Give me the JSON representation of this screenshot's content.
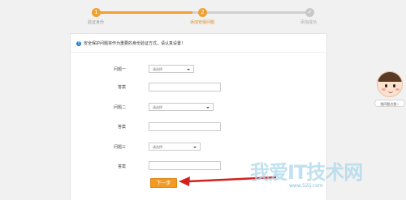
{
  "progress": {
    "steps": [
      {
        "number": "1",
        "label": "验证身份",
        "status": "done"
      },
      {
        "number": "2",
        "label": "添加安保问题",
        "status": "current"
      },
      {
        "number": "",
        "label": "添加成功",
        "status": "pending"
      }
    ],
    "colors": {
      "done": "#f0a02f",
      "current": "#f0a02f",
      "pending": "#c8c8c8"
    }
  },
  "notice": {
    "icon": "info-icon",
    "text": "安全保护问题将作为重要的身份验证方式，请认真设置！"
  },
  "form": {
    "rows": [
      {
        "label": "问题一",
        "kind": "select",
        "value": "请选择"
      },
      {
        "label": "答案",
        "kind": "input",
        "value": ""
      },
      {
        "label": "问题二",
        "kind": "select",
        "value": "请选择"
      },
      {
        "label": "答案",
        "kind": "input",
        "value": ""
      },
      {
        "label": "问题三",
        "kind": "select",
        "value": "请选择"
      },
      {
        "label": "答案",
        "kind": "input",
        "value": ""
      }
    ],
    "next_label": "下一步"
  },
  "feedback": {
    "button_label": "我问题点我~"
  },
  "annotation": {
    "arrow_color": "#d4201e",
    "points_to": "next-button"
  },
  "watermark": {
    "text": "我爱IT技术网",
    "url": "www.52ij.com"
  },
  "colors": {
    "accent": "#f29a22",
    "info": "#1e7fd0"
  }
}
